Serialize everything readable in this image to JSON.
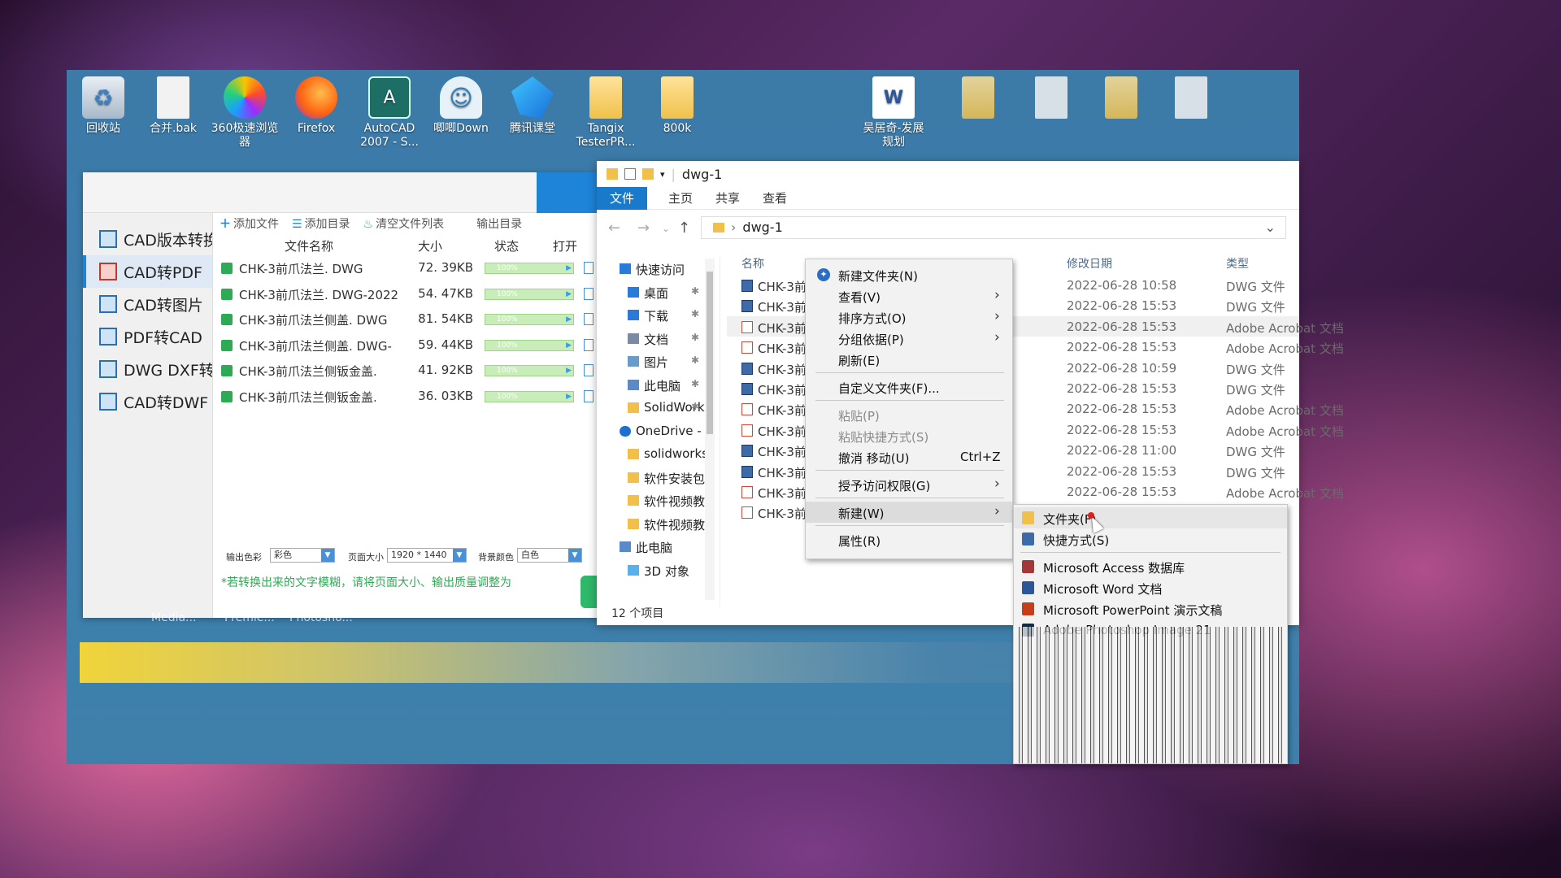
{
  "desktop": {
    "icons": [
      {
        "label": "回收站",
        "icon": "recycle-bin-icon"
      },
      {
        "label": "合并.bak",
        "icon": "file-icon"
      },
      {
        "label": "360极速浏览器",
        "icon": "browser-360-icon"
      },
      {
        "label": "Firefox",
        "icon": "firefox-icon"
      },
      {
        "label": "AutoCAD 2007 - S...",
        "icon": "autocad-icon"
      },
      {
        "label": "唧唧Down",
        "icon": "jijidown-icon"
      },
      {
        "label": "腾讯课堂",
        "icon": "tencent-classroom-icon"
      },
      {
        "label": "Tangix TesterPR...",
        "icon": "folder-icon"
      },
      {
        "label": "800k",
        "icon": "folder-icon"
      },
      {
        "label": "吴居奇-发展规划",
        "icon": "word-doc-icon"
      }
    ],
    "hidden_labels": [
      "Media...",
      "Premie...",
      "Photosho..."
    ]
  },
  "cad_app": {
    "sidebar": [
      {
        "label": "CAD版本转换",
        "active": false
      },
      {
        "label": "CAD转PDF",
        "active": true
      },
      {
        "label": "CAD转图片",
        "active": false
      },
      {
        "label": "PDF转CAD",
        "active": false
      },
      {
        "label": "DWG DXF转换",
        "active": false
      },
      {
        "label": "CAD转DWF",
        "active": false
      }
    ],
    "toolbar": {
      "add_file": "添加文件",
      "add_folder": "添加目录",
      "clear_list": "清空文件列表",
      "output_dir": "输出目录"
    },
    "columns": {
      "name": "文件名称",
      "size": "大小",
      "status": "状态",
      "open": "打开"
    },
    "files": [
      {
        "name": "CHK-3前爪法兰. DWG",
        "size": "72. 39KB",
        "progress": "100%"
      },
      {
        "name": "CHK-3前爪法兰. DWG-2022",
        "size": "54. 47KB",
        "progress": "100%"
      },
      {
        "name": "CHK-3前爪法兰侧盖. DWG",
        "size": "81. 54KB",
        "progress": "100%"
      },
      {
        "name": "CHK-3前爪法兰侧盖. DWG-",
        "size": "59. 44KB",
        "progress": "100%"
      },
      {
        "name": "CHK-3前爪法兰侧钣金盖.",
        "size": "41. 92KB",
        "progress": "100%"
      },
      {
        "name": "CHK-3前爪法兰侧钣金盖.",
        "size": "36. 03KB",
        "progress": "100%"
      }
    ],
    "bottom": {
      "color_label": "输出色彩",
      "color_value": "彩色",
      "page_label": "页面大小",
      "page_value": "1920 * 1440",
      "bg_label": "背景颜色",
      "bg_value": "白色"
    },
    "note": "*若转换出来的文字模糊，请将页面大小、输出质量调整为"
  },
  "explorer": {
    "title": "dwg-1",
    "ribbon": [
      "文件",
      "主页",
      "共享",
      "查看"
    ],
    "address": "dwg-1",
    "tree": [
      {
        "label": "快速访问",
        "icon": "star-icon",
        "indent": 0
      },
      {
        "label": "桌面",
        "icon": "desktop-icon",
        "indent": 1,
        "pinned": true
      },
      {
        "label": "下载",
        "icon": "download-icon",
        "indent": 1,
        "pinned": true
      },
      {
        "label": "文档",
        "icon": "document-icon",
        "indent": 1,
        "pinned": true
      },
      {
        "label": "图片",
        "icon": "picture-icon",
        "indent": 1,
        "pinned": true
      },
      {
        "label": "此电脑",
        "icon": "computer-icon",
        "indent": 1,
        "pinned": true
      },
      {
        "label": "SolidWorks",
        "icon": "folder-icon",
        "indent": 1,
        "pinned": true
      },
      {
        "label": "OneDrive -",
        "icon": "onedrive-icon",
        "indent": 0
      },
      {
        "label": "solidworks",
        "icon": "folder-icon",
        "indent": 1
      },
      {
        "label": "软件安装包",
        "icon": "folder-icon",
        "indent": 1
      },
      {
        "label": "软件视频教",
        "icon": "folder-icon",
        "indent": 1
      },
      {
        "label": "软件视频教",
        "icon": "folder-icon",
        "indent": 1
      },
      {
        "label": "此电脑",
        "icon": "computer-icon",
        "indent": 0
      },
      {
        "label": "3D 对象",
        "icon": "3d-objects-icon",
        "indent": 1
      }
    ],
    "columns": {
      "name": "名称",
      "date": "修改日期",
      "type": "类型"
    },
    "files": [
      {
        "name": "CHK-3前",
        "kind": "dwg",
        "date": "2022-06-28 10:58",
        "type": "DWG 文件"
      },
      {
        "name": "CHK-3前",
        "kind": "dwg",
        "date": "2022-06-28 15:53",
        "type": "DWG 文件"
      },
      {
        "name": "CHK-3前",
        "kind": "pdf",
        "date": "2022-06-28 15:53",
        "type": "Adobe Acrobat 文档"
      },
      {
        "name": "CHK-3前",
        "kind": "pdf",
        "date": "2022-06-28 15:53",
        "type": "Adobe Acrobat 文档"
      },
      {
        "name": "CHK-3前",
        "kind": "dwg",
        "date": "2022-06-28 10:59",
        "type": "DWG 文件"
      },
      {
        "name": "CHK-3前",
        "kind": "dwg",
        "date": "2022-06-28 15:53",
        "type": "DWG 文件"
      },
      {
        "name": "CHK-3前",
        "kind": "pdf",
        "date": "2022-06-28 15:53",
        "type": "Adobe Acrobat 文档"
      },
      {
        "name": "CHK-3前",
        "kind": "pdf",
        "date": "2022-06-28 15:53",
        "type": "Adobe Acrobat 文档"
      },
      {
        "name": "CHK-3前",
        "kind": "dwg",
        "date": "2022-06-28 11:00",
        "type": "DWG 文件"
      },
      {
        "name": "CHK-3前",
        "kind": "dwg",
        "date": "2022-06-28 15:53",
        "type": "DWG 文件"
      },
      {
        "name": "CHK-3前",
        "kind": "pdf",
        "date": "2022-06-28 15:53",
        "type": "Adobe Acrobat 文档"
      },
      {
        "name": "CHK-3前",
        "kind": "pdf",
        "date": "",
        "type": ""
      }
    ],
    "status": "12 个项目"
  },
  "context_menu": {
    "items": [
      {
        "label": "新建文件夹(N)",
        "icon": "new-folder-icon",
        "sep_after": false
      },
      {
        "label": "查看(V)",
        "submenu": true
      },
      {
        "label": "排序方式(O)",
        "submenu": true
      },
      {
        "label": "分组依据(P)",
        "submenu": true
      },
      {
        "label": "刷新(E)",
        "sep_after": true
      },
      {
        "label": "自定义文件夹(F)...",
        "sep_after": true
      },
      {
        "label": "粘贴(P)",
        "disabled": true
      },
      {
        "label": "粘贴快捷方式(S)",
        "disabled": true
      },
      {
        "label": "撤消 移动(U)",
        "shortcut": "Ctrl+Z",
        "sep_after": true
      },
      {
        "label": "授予访问权限(G)",
        "submenu": true,
        "sep_after": true
      },
      {
        "label": "新建(W)",
        "submenu": true,
        "highlighted": true,
        "sep_after": true
      },
      {
        "label": "属性(R)"
      }
    ]
  },
  "new_submenu": {
    "items": [
      {
        "label": "文件夹(F)",
        "icon": "folder-icon",
        "highlighted": true
      },
      {
        "label": "快捷方式(S)",
        "icon": "shortcut-icon",
        "sep_after": true
      },
      {
        "label": "Microsoft Access 数据库",
        "icon": "access-icon"
      },
      {
        "label": "Microsoft Word 文档",
        "icon": "word-icon"
      },
      {
        "label": "Microsoft PowerPoint 演示文稿",
        "icon": "powerpoint-icon"
      },
      {
        "label": "Adobe Photoshop Image 21",
        "icon": "photoshop-icon"
      }
    ]
  },
  "colors": {
    "accent": "#1979ca",
    "desktop_bg": "#3d7fad",
    "dwg_icon": "#3d6ba8",
    "pdf_icon": "#d04a3a",
    "progress_bar": "#c9edb9",
    "note_green": "#2eaa55"
  }
}
